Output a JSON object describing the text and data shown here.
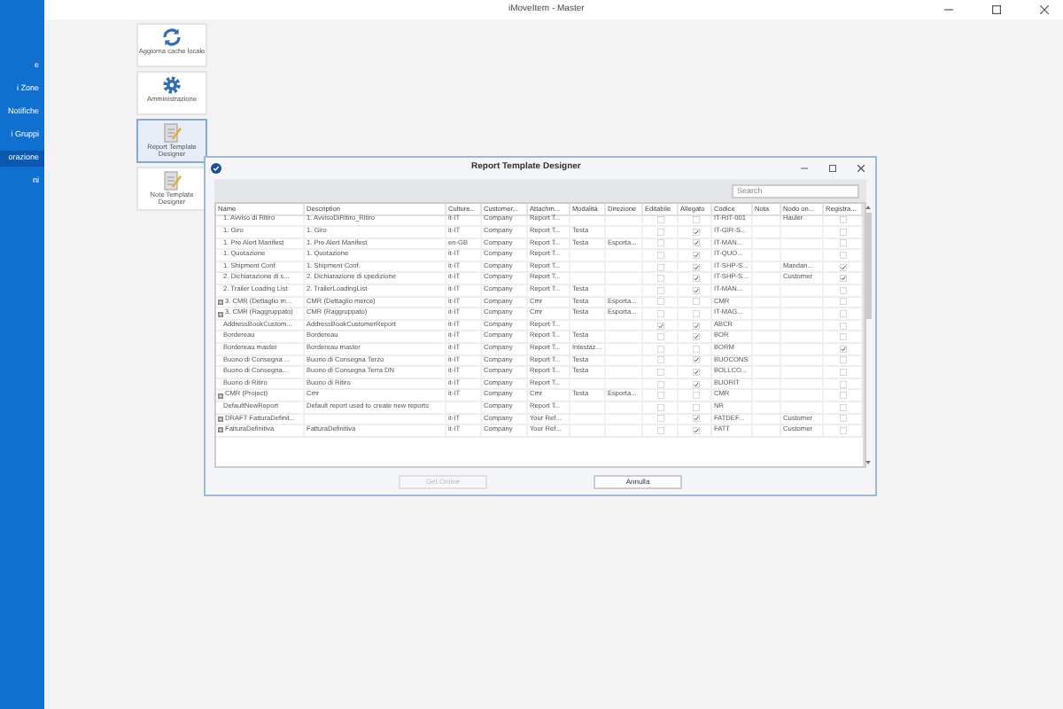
{
  "window": {
    "title": "iMoveItem - Master"
  },
  "sidebar": {
    "items": [
      {
        "label": "e",
        "selected": false
      },
      {
        "label": "i Zone",
        "selected": false
      },
      {
        "label": "Notifiche",
        "selected": false
      },
      {
        "label": "i Gruppi",
        "selected": false
      },
      {
        "label": "orazione",
        "selected": true
      },
      {
        "label": "ni",
        "selected": false
      }
    ]
  },
  "toolbar": {
    "buttons": [
      {
        "label": "Aggiorna cache locale",
        "kind": "refresh",
        "selected": false
      },
      {
        "label": "Amministrazione",
        "kind": "gear",
        "selected": false
      },
      {
        "label": "Report Template Designer",
        "kind": "document",
        "selected": true
      },
      {
        "label": "Note Template Designer",
        "kind": "document",
        "selected": false
      }
    ]
  },
  "dialog": {
    "title": "Report Template Designer",
    "search": {
      "placeholder": "Search"
    },
    "columns": [
      "Name",
      "Description",
      "Culture...",
      "Customer...",
      "Attachm...",
      "Modalità",
      "Direzione",
      "Editabile",
      "Allegato",
      "Codice",
      "Nota",
      "Nodo on...",
      "Registra..."
    ],
    "rows": [
      {
        "expandable": false,
        "name": "1. Avviso di Ritiro",
        "description": "1. AvvisoDiRitiro_Ritiro",
        "culture": "it-IT",
        "customer": "Company",
        "attach": "Report T...",
        "code": "IT-RIT-001",
        "node": "Hauler",
        "editable": false,
        "attachment": false,
        "register": false
      },
      {
        "expandable": false,
        "name": "1. Giro",
        "description": "1. Giro",
        "culture": "it-IT",
        "customer": "Company",
        "attach": "Report T...",
        "mode": "Testa",
        "code": "IT-GIR-S...",
        "editable": false,
        "attachment": true,
        "register": false
      },
      {
        "expandable": false,
        "name": "1. Pre Alert Manifest",
        "description": "1. Pre Alert Manifest",
        "culture": "en-GB",
        "customer": "Company",
        "attach": "Report T...",
        "mode": "Testa",
        "direction": "Esporta...",
        "code": "IT-MAN...",
        "editable": false,
        "attachment": true,
        "register": false
      },
      {
        "expandable": false,
        "name": "1. Quotazione",
        "description": "1. Quotazione",
        "culture": "it-IT",
        "customer": "Company",
        "attach": "Report T...",
        "code": "IT-QUO...",
        "editable": false,
        "attachment": true,
        "register": false
      },
      {
        "expandable": false,
        "name": "1. Shipment Conf.",
        "description": "1. Shipment Conf.",
        "culture": "it-IT",
        "customer": "Company",
        "attach": "Report T...",
        "code": "IT-SHP-S...",
        "node": "Mandan...",
        "editable": false,
        "attachment": true,
        "register": true
      },
      {
        "expandable": false,
        "name": "2. Dichiarazione di s...",
        "description": "2. Dichiarazione di spedizione",
        "culture": "it-IT",
        "customer": "Company",
        "attach": "Report T...",
        "code": "IT-SHP-S...",
        "node": "Customer",
        "editable": false,
        "attachment": true,
        "register": true
      },
      {
        "expandable": false,
        "name": "2. Trailer Loading List",
        "description": "2. TrailerLoadingList",
        "culture": "it-IT",
        "customer": "Company",
        "attach": "Report T...",
        "mode": "Testa",
        "code": "IT-MAN...",
        "editable": false,
        "attachment": true,
        "register": false
      },
      {
        "expandable": true,
        "name": "3. CMR (Dettaglio m...",
        "description": "CMR (Dettaglio merce)",
        "culture": "it-IT",
        "customer": "Company",
        "attach": "Cmr",
        "mode": "Testa",
        "direction": "Esporta...",
        "code": "CMR",
        "editable": false,
        "attachment": false,
        "register": false
      },
      {
        "expandable": true,
        "name": "3. CMR (Raggruppato)",
        "description": "CMR (Raggruppato)",
        "culture": "it-IT",
        "customer": "Company",
        "attach": "Cmr",
        "mode": "Testa",
        "direction": "Esporta...",
        "code": "IT-MAG...",
        "editable": false,
        "attachment": false,
        "register": false
      },
      {
        "expandable": false,
        "name": "AddressBookCustom...",
        "description": "AddressBookCustomerReport",
        "culture": "it-IT",
        "customer": "Company",
        "attach": "Report T...",
        "code": "ABCR",
        "editable": true,
        "attachment": true,
        "register": false
      },
      {
        "expandable": false,
        "name": "Bordereau",
        "description": "Bordereau",
        "culture": "it-IT",
        "customer": "Company",
        "attach": "Report T...",
        "mode": "Testa",
        "code": "BOR",
        "editable": false,
        "attachment": true,
        "register": false
      },
      {
        "expandable": false,
        "name": "Bordereau master",
        "description": "Bordereau master",
        "culture": "it-IT",
        "customer": "Company",
        "attach": "Report T...",
        "mode": "Intestaz...",
        "code": "BORM",
        "editable": false,
        "attachment": false,
        "register": true
      },
      {
        "expandable": false,
        "name": "Buono di Consegna ...",
        "description": "Buono di Consegna Terzo",
        "culture": "it-IT",
        "customer": "Company",
        "attach": "Report T...",
        "mode": "Testa",
        "code": "BUOCONS",
        "editable": false,
        "attachment": true,
        "register": false
      },
      {
        "expandable": false,
        "name": "Buono di Consegna...",
        "description": "Buono di Consegna Terra DN",
        "culture": "it-IT",
        "customer": "Company",
        "attach": "Report T...",
        "mode": "Testa",
        "code": "BOLLCO...",
        "editable": false,
        "attachment": true,
        "register": false
      },
      {
        "expandable": false,
        "name": "Buono di Ritiro",
        "description": "Buono di Ritiro",
        "culture": "it-IT",
        "customer": "Company",
        "attach": "Report T...",
        "code": "BUORIT",
        "editable": false,
        "attachment": true,
        "register": false
      },
      {
        "expandable": true,
        "name": "CMR (Project)",
        "description": "Cmr",
        "culture": "it-IT",
        "customer": "Company",
        "attach": "Cmr",
        "mode": "Testa",
        "direction": "Esporta...",
        "code": "CMR",
        "editable": false,
        "attachment": false,
        "register": false
      },
      {
        "expandable": false,
        "name": "DefaultNewReport",
        "description": "Default report used to create new reports",
        "customer": "Company",
        "attach": "Report T...",
        "code": "NR",
        "editable": false,
        "attachment": false,
        "register": false
      },
      {
        "expandable": true,
        "name": "DRAFT FatturaDefinit...",
        "culture": "it-IT",
        "customer": "Company",
        "attach": "Your Ref...",
        "code": "FATDEF...",
        "node": "Customer",
        "editable": false,
        "attachment": true,
        "register": false
      },
      {
        "expandable": true,
        "name": "FatturaDefinitiva",
        "description": "FatturaDefinitiva",
        "culture": "it-IT",
        "customer": "Company",
        "attach": "Your Ref...",
        "code": "FATT",
        "node": "Customer",
        "editable": false,
        "attachment": true,
        "register": false
      }
    ],
    "buttons": [
      {
        "label": "Get Online",
        "disabled": true
      },
      {
        "label": "Annulla",
        "disabled": false
      }
    ]
  }
}
